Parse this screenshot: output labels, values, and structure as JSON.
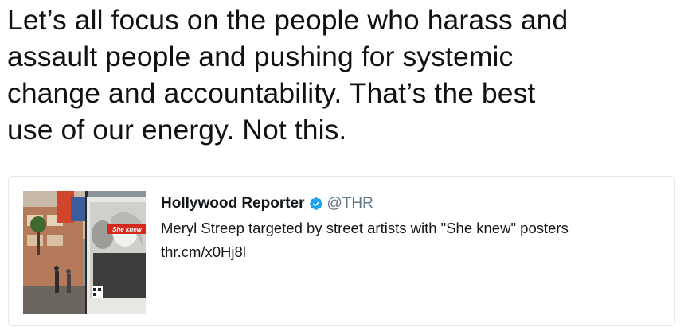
{
  "tweet": {
    "text": "Let’s all focus on the people who harass and\nassault people and pushing for systemic\nchange and accountability. That’s the best\nuse of our energy. Not this."
  },
  "quoted_tweet": {
    "account_name": "Hollywood Reporter",
    "handle": "@THR",
    "verified": true,
    "verified_icon": "verified-badge-icon",
    "headline": "Meryl Streep targeted by street artists with \"She knew\" posters",
    "link": "thr.cm/x0Hj8l",
    "thumbnail": {
      "poster_text": "She knew"
    }
  },
  "colors": {
    "text": "#14171a",
    "secondary": "#657786",
    "verified": "#1da1f2",
    "border": "#e1e8ed",
    "poster_banner": "#d42a1e"
  }
}
